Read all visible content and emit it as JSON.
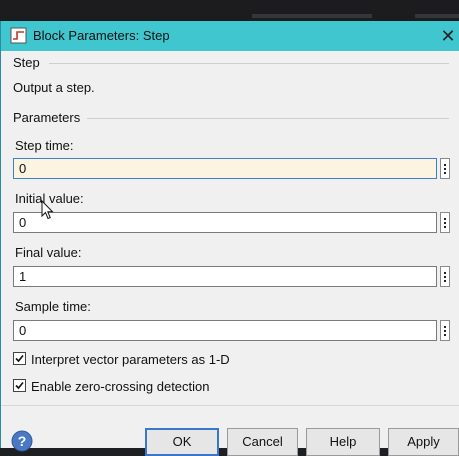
{
  "window": {
    "title": "Block Parameters: Step",
    "close_glyph": "✕"
  },
  "block": {
    "name": "Step",
    "description": "Output a step."
  },
  "parameters": {
    "group_label": "Parameters",
    "step_time": {
      "label": "Step time:",
      "value": "0"
    },
    "initial_value": {
      "label": "Initial value:",
      "value": "0"
    },
    "final_value": {
      "label": "Final value:",
      "value": "1"
    },
    "sample_time": {
      "label": "Sample time:",
      "value": "0"
    }
  },
  "options": {
    "interpret_vector": {
      "label": "Interpret vector parameters as 1-D",
      "checked": true
    },
    "zero_crossing": {
      "label": "Enable zero-crossing detection",
      "checked": true
    }
  },
  "buttons": {
    "ok": "OK",
    "cancel": "Cancel",
    "help": "Help",
    "apply": "Apply"
  },
  "colors": {
    "titlebar": "#3fc6cf",
    "active_field_bg": "#fdf3e1",
    "focus_border": "#3b7fd0"
  }
}
